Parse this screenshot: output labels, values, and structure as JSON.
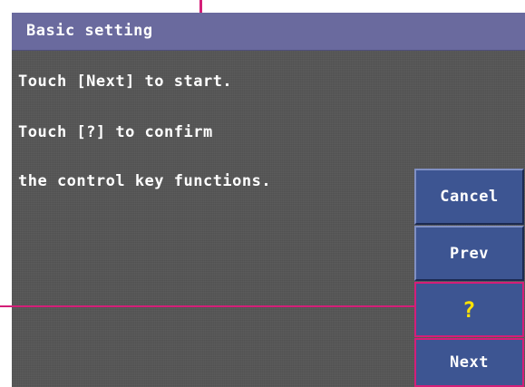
{
  "title_bar": {
    "title": "Basic setting",
    "background_color": "#6a6a9e"
  },
  "message": {
    "line1": "Touch [Next] to start.",
    "line2": "Touch [?] to confirm",
    "line3": "the control key functions."
  },
  "buttons": {
    "cancel_label": "Cancel",
    "prev_label": "Prev",
    "help_label": "?",
    "next_label": "Next",
    "button_color": "#3d5592",
    "highlight_color": "#d41e78",
    "help_text_color": "#ffe300"
  },
  "screen": {
    "background_color": "#565656"
  }
}
